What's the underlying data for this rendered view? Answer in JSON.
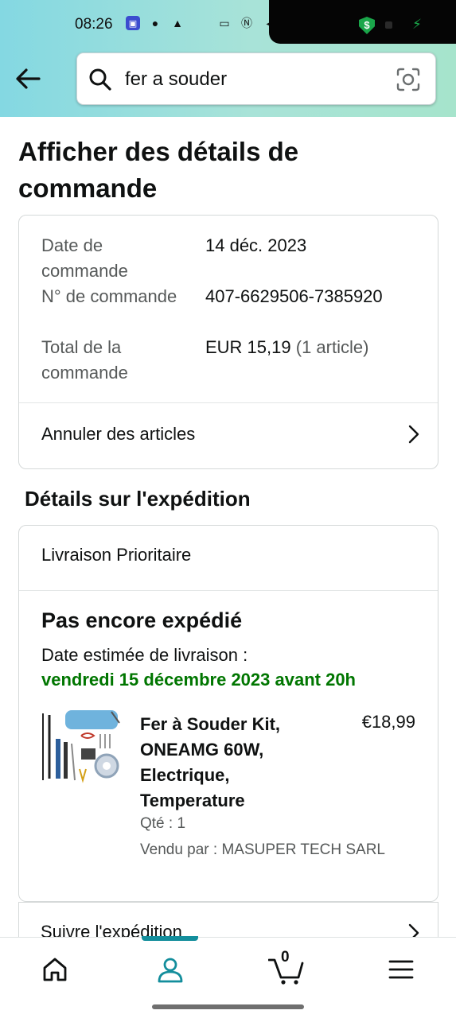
{
  "status_bar": {
    "time": "08:26"
  },
  "search": {
    "query": "fer a souder"
  },
  "page_title": "Afficher des détails de commande",
  "order_summary": {
    "rows": [
      {
        "label": "Date de commande",
        "value": "14 déc. 2023",
        "extra": ""
      },
      {
        "label": "N° de commande",
        "value": "407-6629506-7385920",
        "extra": ""
      },
      {
        "label": "Total de la commande",
        "value": "EUR 15,19",
        "extra": "(1 article)"
      }
    ],
    "cancel_label": "Annuler des articles"
  },
  "shipping": {
    "section_title": "Détails sur l'expédition",
    "method": "Livraison Prioritaire",
    "status": "Pas encore expédié",
    "eta_label": "Date estimée de livraison :",
    "eta_date": "vendredi 15 décembre 2023 avant 20h",
    "item": {
      "name": "Fer à Souder Kit, ONEAMG 60W, Electrique, Temperature",
      "price": "€18,99",
      "qty": "Qté : 1",
      "seller": "Vendu par : MASUPER TECH SARL"
    },
    "track_label": "Suivre l'expédition"
  },
  "bottom_nav": {
    "cart_count": "0"
  },
  "colors": {
    "eta_green": "#007600",
    "nav_accent": "#138e9c",
    "header_start": "#84d8e2",
    "header_end": "#a6e4cc"
  }
}
